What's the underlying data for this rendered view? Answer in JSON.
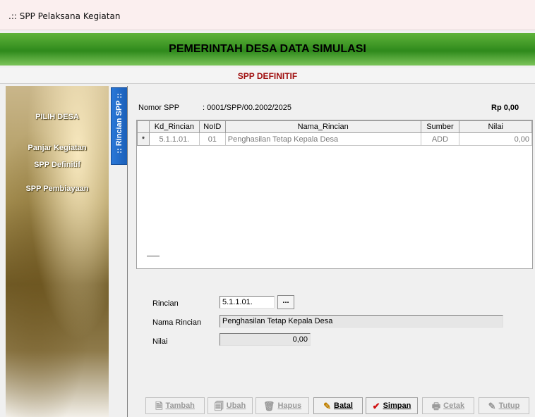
{
  "window": {
    "title": ".:: SPP Pelaksana Kegiatan"
  },
  "header": {
    "title": "PEMERINTAH DESA DATA SIMULASI"
  },
  "subheader": {
    "title": "SPP DEFINITIF"
  },
  "sidebar": {
    "items": [
      {
        "label": "PILIH DESA"
      },
      {
        "label": "Panjar Kegiatan"
      },
      {
        "label": "SPP Definitif"
      },
      {
        "label": "SPP Pembiayaan"
      }
    ],
    "tab_label": ":: Rincian SPP ::"
  },
  "form": {
    "nomor_spp_label": "Nomor SPP",
    "nomor_spp_value": ": 0001/SPP/00.2002/2025",
    "total_amount": "Rp 0,00",
    "rincian_label": "Rincian",
    "rincian_value": "5.1.1.01.",
    "browse_label": "...",
    "nama_rincian_label": "Nama Rincian",
    "nama_rincian_value": "Penghasilan Tetap Kepala Desa",
    "nilai_label": "Nilai",
    "nilai_value": "0,00"
  },
  "grid": {
    "columns": [
      "Kd_Rincian",
      "NoID",
      "Nama_Rincian",
      "Sumber",
      "Nilai"
    ],
    "rows": [
      {
        "indicator": "*",
        "kd_rincian": "5.1.1.01.",
        "noid": "01",
        "nama_rincian": "Penghasilan Tetap Kepala Desa",
        "sumber": "ADD",
        "nilai": "0,00"
      }
    ]
  },
  "buttons": {
    "tambah": "Tambah",
    "ubah": "Ubah",
    "hapus": "Hapus",
    "batal": "Batal",
    "simpan": "Simpan",
    "cetak": "Cetak",
    "tutup": "Tutup"
  },
  "colors": {
    "header_green": "#3f9a2a",
    "subheader_red": "#a01010",
    "tab_blue": "#1b5fb8"
  }
}
